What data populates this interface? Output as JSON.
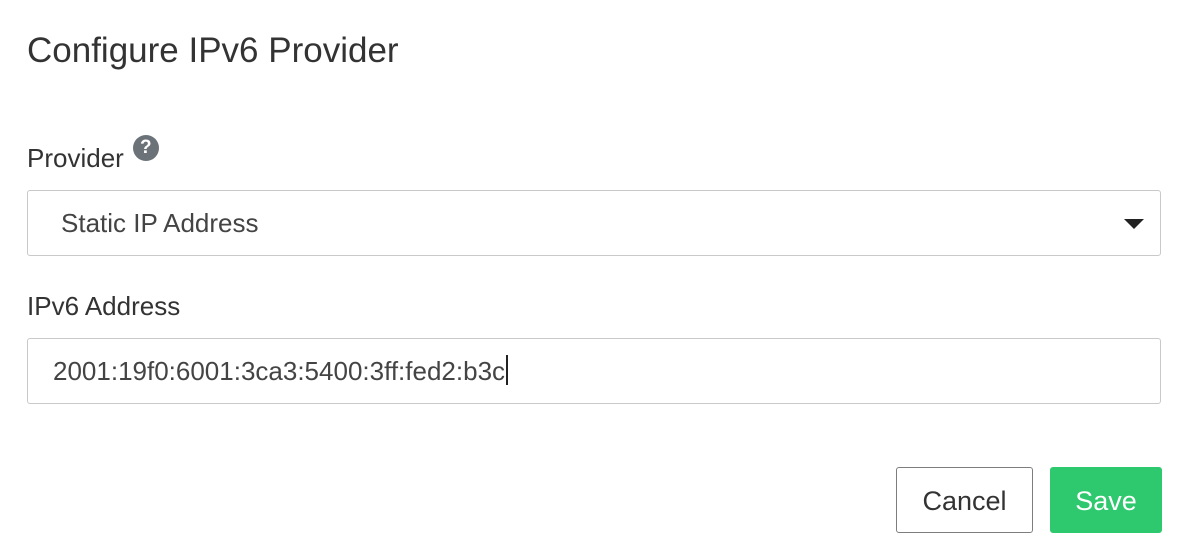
{
  "dialog": {
    "title": "Configure IPv6 Provider"
  },
  "provider": {
    "label": "Provider",
    "help_icon_glyph": "?",
    "help_icon": "question-circle-icon",
    "selected": "Static IP Address"
  },
  "ipv6": {
    "label": "IPv6 Address",
    "value": "2001:19f0:6001:3ca3:5400:3ff:fed2:b3c"
  },
  "buttons": {
    "cancel": "Cancel",
    "save": "Save"
  },
  "colors": {
    "save_button": "#2ec86e",
    "text": "#333333",
    "border": "#c9c9c9",
    "help_icon": "#6b7278"
  }
}
